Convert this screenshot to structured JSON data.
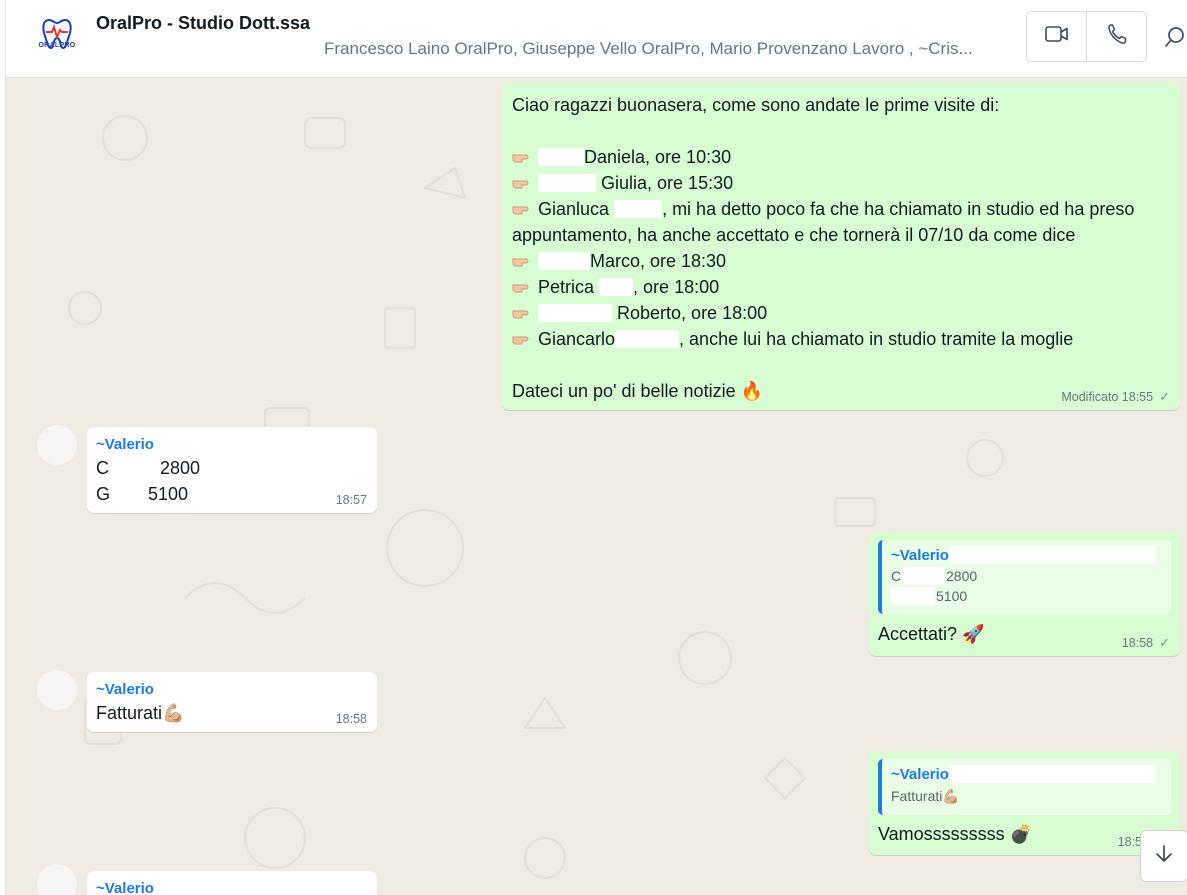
{
  "header": {
    "title": "OralPro - Studio Dott.ssa",
    "members": "Francesco Laino OralPro, Giuseppe Vello OralPro, Mario Provenzano Lavoro , ~Cris...",
    "logo_text": "ORALPRO",
    "video_icon": "video-camera-icon",
    "call_icon": "phone-icon",
    "search_icon": "search-icon"
  },
  "messages": {
    "m1": {
      "intro": "Ciao ragazzi buonasera, come sono andate le prime visite di:",
      "line1": "Daniela, ore 10:30",
      "line2": "Giulia, ore 15:30",
      "line3a": "Gianluca",
      "line3b": ", mi ha detto poco fa che ha chiamato in studio ed ha preso",
      "line3c": "appuntamento, ha anche accettato e che tornerà il 07/10 da come dice",
      "line4": "Marco, ore 18:30",
      "line5a": "Petrica",
      "line5b": ", ore 18:00",
      "line6": "Roberto, ore 18:00",
      "line7a": "Giancarlo",
      "line7b": ", anche lui ha chiamato in studio tramite la moglie",
      "outro": "Dateci un po' di belle notizie 🔥",
      "meta": "Modificato 18:55"
    },
    "m2": {
      "sender": "~Valerio",
      "row1_letter": "C",
      "row1_value": "2800",
      "row2_letter": "G",
      "row2_value": "5100",
      "time": "18:57"
    },
    "m3": {
      "quote_sender": "~Valerio",
      "quote_line1_letter": "C",
      "quote_line1_value": "2800",
      "quote_line2_value": "5100",
      "text": "Accettati? 🚀",
      "time": "18:58"
    },
    "m4": {
      "sender": "~Valerio",
      "text": "Fatturati💪🏼",
      "time": "18:58"
    },
    "m5": {
      "quote_sender": "~Valerio",
      "quote_text": "Fatturati💪🏼",
      "text": "Vamosssssssss 💣",
      "time": "18:5"
    },
    "m6": {
      "sender": "~Valerio"
    }
  },
  "status": {
    "read_tick": "✓"
  },
  "colors": {
    "outgoing": "#d9fdd3",
    "incoming": "#ffffff",
    "sender": "#1f7bd6",
    "background": "#efeae2"
  },
  "icons": {
    "scroll_down": "arrow-down-icon"
  }
}
